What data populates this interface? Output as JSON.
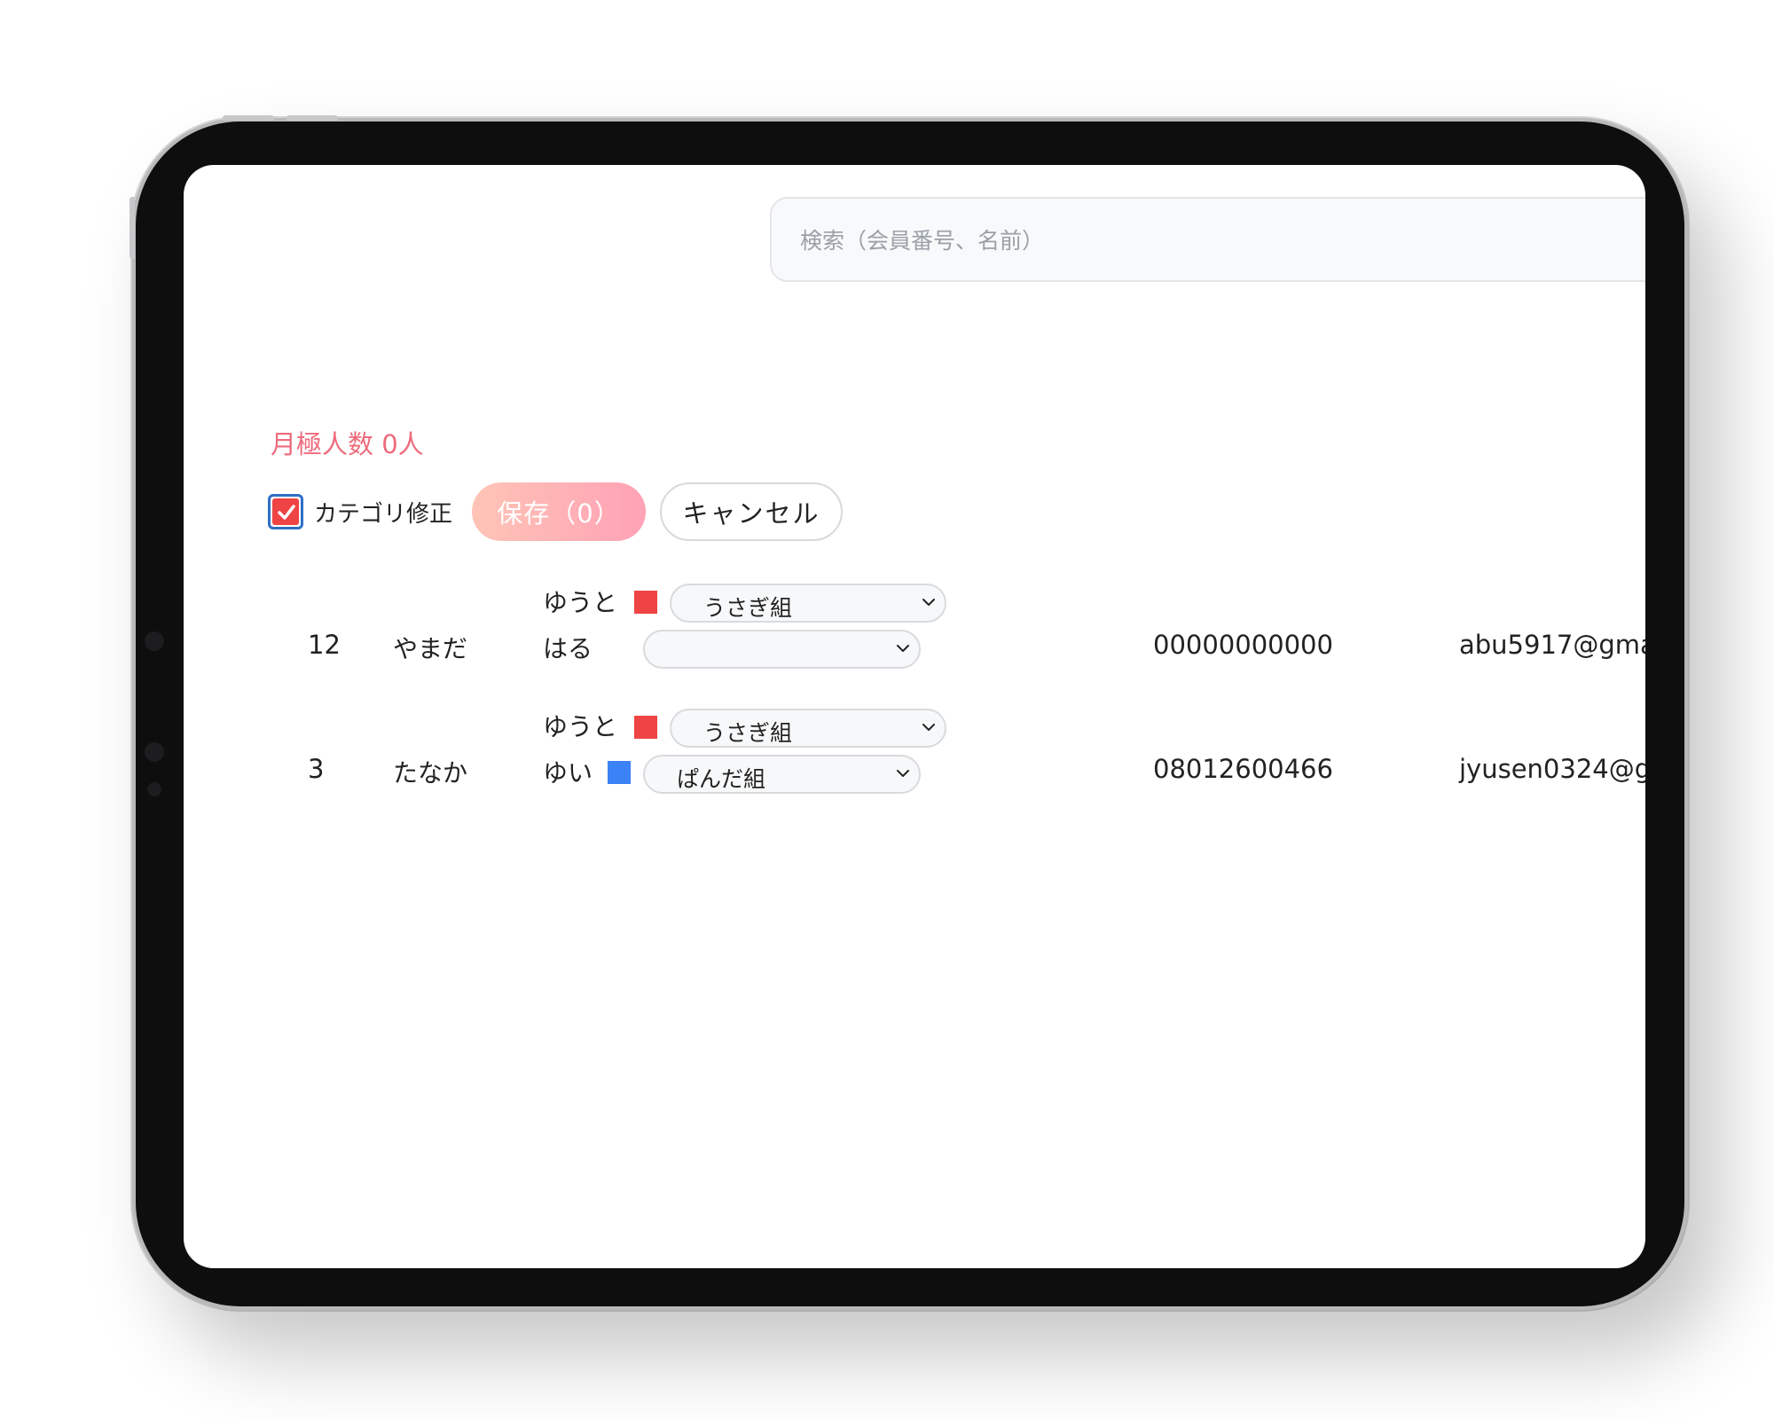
{
  "search": {
    "placeholder": "検索（会員番号、名前）",
    "value": ""
  },
  "summary": {
    "monthly_count_label": "月極人数 0人"
  },
  "toolbar": {
    "category_edit_label": "カテゴリ修正",
    "category_edit_checked": true,
    "save_label": "保存（0）",
    "cancel_label": "キャンセル"
  },
  "colors": {
    "accent_pink": "#ee6b7c",
    "checkbox_red": "#ef4444",
    "checkbox_border": "#2f6fc6",
    "usagi_red": "#ef4444",
    "panda_blue": "#3b82f6"
  },
  "members": [
    {
      "number": "12",
      "name": "やまだ",
      "children": [
        {
          "name": "ゆうと",
          "color": "#ef4444",
          "class": "うさぎ組"
        },
        {
          "name": "はる",
          "color": "",
          "class": ""
        }
      ],
      "phone": "00000000000",
      "email": "abu5917@gma"
    },
    {
      "number": "3",
      "name": "たなか",
      "children": [
        {
          "name": "ゆうと",
          "color": "#ef4444",
          "class": "うさぎ組"
        },
        {
          "name": "ゆい",
          "color": "#3b82f6",
          "class": "ぱんだ組"
        }
      ],
      "phone": "08012600466",
      "email": "jyusen0324@g"
    }
  ],
  "icons": {
    "checkbox": "check-icon",
    "select": "chevron-down-icon"
  }
}
